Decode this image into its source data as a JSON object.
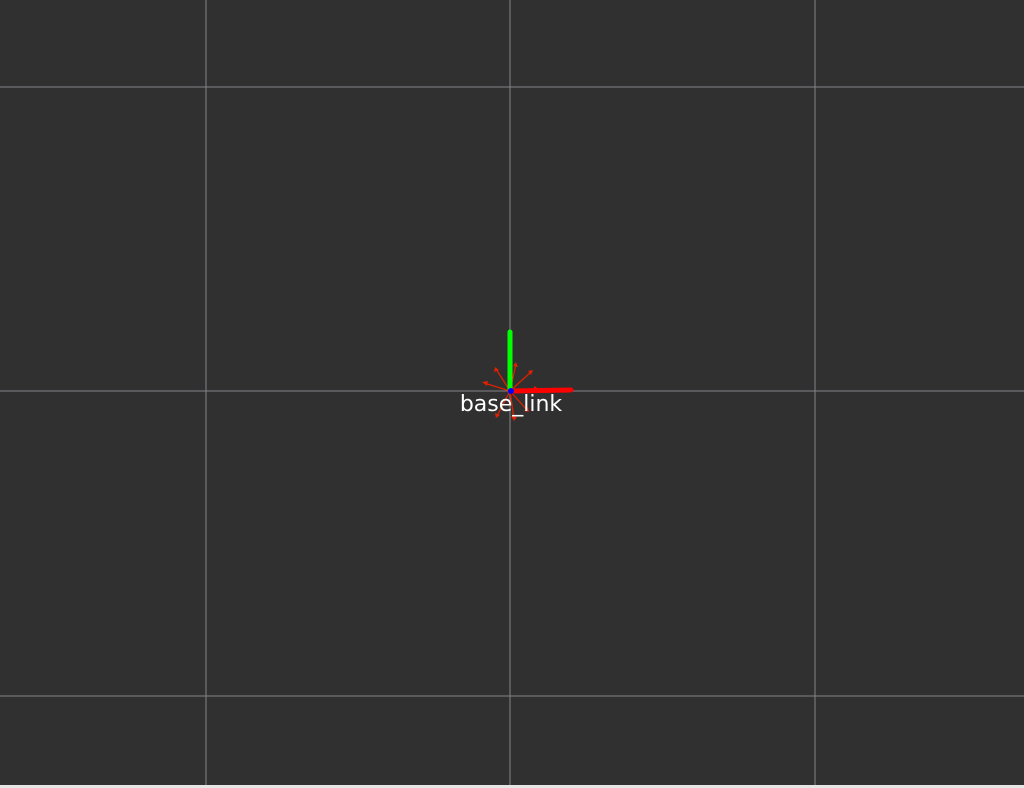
{
  "scene": {
    "background_color": "#303030",
    "grid_color": "#a0a0a4"
  },
  "tf_frame": {
    "name": "base_link",
    "x_axis_color": "#ff0000",
    "y_axis_color": "#00ff00",
    "z_axis_color": "#0000ff",
    "arrow_color": "#e02000"
  }
}
